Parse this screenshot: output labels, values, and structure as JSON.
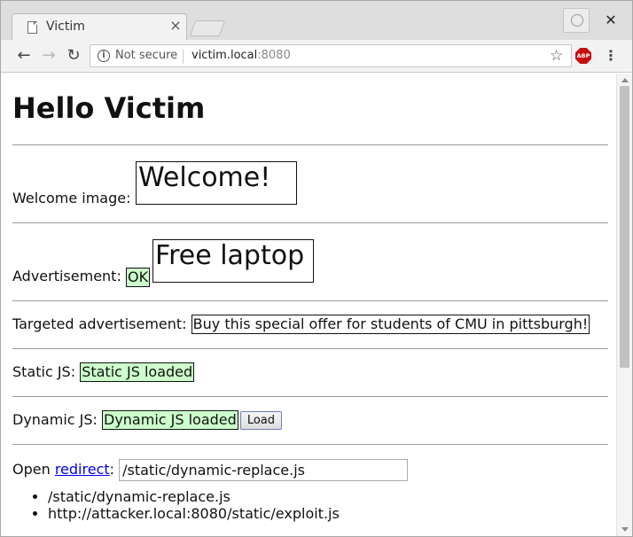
{
  "browser": {
    "tab_title": "Victim",
    "tab_close": "×",
    "window_close": "✕",
    "security_label": "Not secure",
    "url_host": "victim.local",
    "url_port": ":8080",
    "back": "←",
    "forward": "→",
    "reload": "↻",
    "star": "☆",
    "abp_label": "ABP",
    "menu": "⋮",
    "info": "i"
  },
  "page": {
    "heading": "Hello Victim",
    "welcome": {
      "label": "Welcome image: ",
      "box_text": "Welcome!"
    },
    "advertisement": {
      "label": "Advertisement: ",
      "status": "OK",
      "box_text": "Free laptop"
    },
    "targeted": {
      "label": "Targeted advertisement: ",
      "text": "Buy this special offer for students of CMU in pittsburgh!"
    },
    "static_js": {
      "label": "Static JS: ",
      "status": "Static JS loaded"
    },
    "dynamic_js": {
      "label": "Dynamic JS: ",
      "status": "Dynamic JS loaded",
      "button": "Load"
    },
    "redirect": {
      "prefix": "Open ",
      "link": "redirect",
      "suffix": ":",
      "input_value": "/static/dynamic-replace.js"
    },
    "list": [
      "/static/dynamic-replace.js",
      "http://attacker.local:8080/static/exploit.js"
    ]
  },
  "colors": {
    "status_green": "#ccffcc",
    "link": "#0000ee"
  }
}
